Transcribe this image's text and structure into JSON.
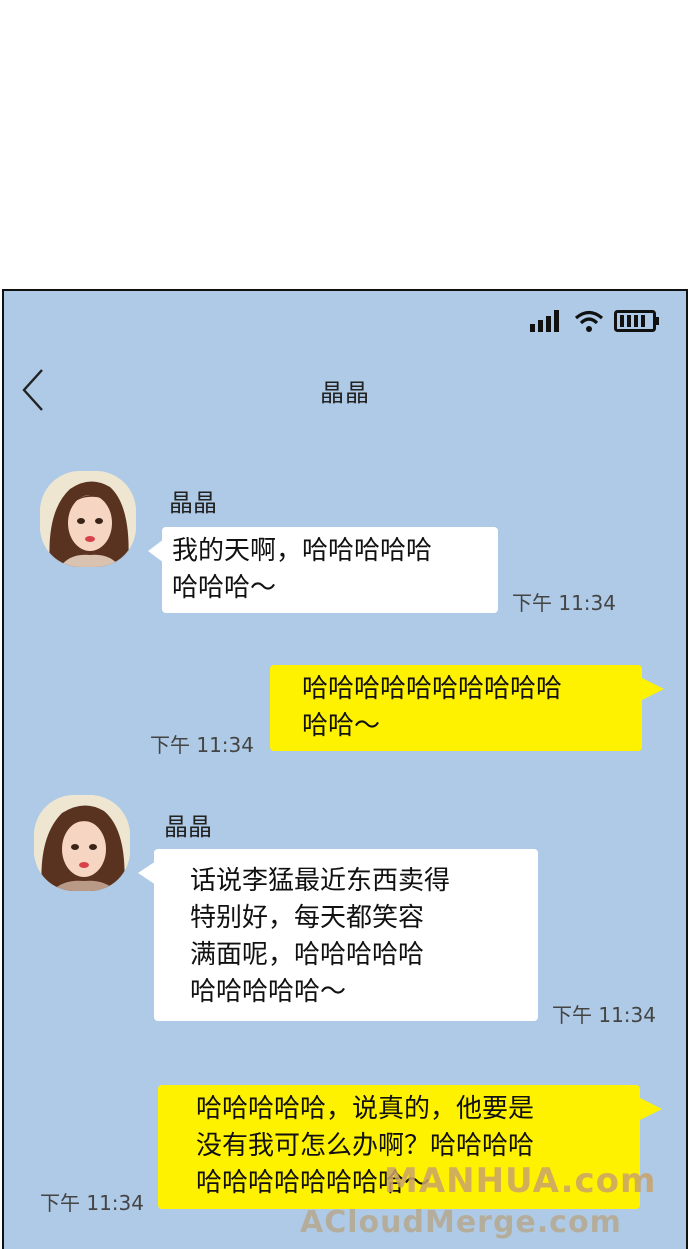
{
  "header": {
    "title": "晶晶"
  },
  "messages": [
    {
      "sender": "晶晶",
      "text": "我的天啊，哈哈哈哈哈\n哈哈哈～",
      "time": "下午 11:34"
    },
    {
      "text": "哈哈哈哈哈哈哈哈哈哈\n哈哈～",
      "time": "下午 11:34"
    },
    {
      "sender": "晶晶",
      "text": "话说李猛最近东西卖得\n特别好，每天都笑容\n满面呢，哈哈哈哈哈\n哈哈哈哈哈～",
      "time": "下午 11:34"
    },
    {
      "text": "哈哈哈哈哈，说真的，他要是\n没有我可怎么办啊？哈哈哈哈\n哈哈哈哈哈哈哈哈～",
      "time": "下午 11:34"
    }
  ],
  "watermark": {
    "line1": "MANHUA.com",
    "line2": "ACloudMerge.com"
  },
  "colors": {
    "chat_bg": "#aecae6",
    "incoming": "#ffffff",
    "outgoing": "#fff200"
  },
  "icons": [
    "signal-icon",
    "wifi-icon",
    "battery-icon",
    "back-chevron-icon",
    "avatar"
  ]
}
